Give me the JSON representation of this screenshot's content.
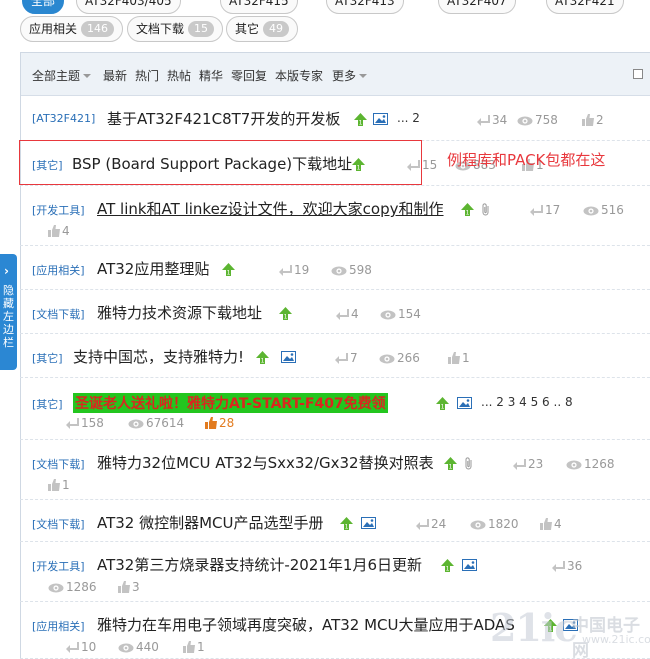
{
  "category_pills": [
    {
      "label": "全部",
      "count": "",
      "active": true
    },
    {
      "label": "AT32F403/405",
      "count": "",
      "active": false
    },
    {
      "label": "AT32F415",
      "count": "",
      "active": false
    },
    {
      "label": "AT32F413",
      "count": "",
      "active": false
    },
    {
      "label": "AT32F407",
      "count": "",
      "active": false
    },
    {
      "label": "AT32F421",
      "count": "",
      "active": false
    },
    {
      "label": "应用相关",
      "count": "146",
      "active": false
    },
    {
      "label": "文档下载",
      "count": "15",
      "active": false
    },
    {
      "label": "其它",
      "count": "49",
      "active": false
    }
  ],
  "toolbar": {
    "all_topics": "全部主题",
    "latest": "最新",
    "hot": "热门",
    "trending": "热帖",
    "digest": "精华",
    "zero_reply": "零回复",
    "expert": "本版专家",
    "more": "更多"
  },
  "sidebar_toggle": {
    "label": "隐藏左边栏"
  },
  "annotation": {
    "text": "例程库和PACK包都在这"
  },
  "threads": [
    {
      "tag": "[AT32F421]",
      "title": "基于AT32F421C8T7开发的开发板",
      "pages": "... 2",
      "replies": "34",
      "views": "758",
      "likes": "2"
    },
    {
      "tag": "[其它]",
      "title": "BSP (Board Support Package)下载地址",
      "pages": "",
      "replies": "15",
      "views": "883",
      "likes": "1"
    },
    {
      "tag": "[开发工具]",
      "title": "AT link和AT linkez设计文件，欢迎大家copy和制作",
      "pages": "",
      "replies": "17",
      "views": "516",
      "likes": "4"
    },
    {
      "tag": "[应用相关]",
      "title": "AT32应用整理贴",
      "pages": "",
      "replies": "19",
      "views": "598",
      "likes": ""
    },
    {
      "tag": "[文档下载]",
      "title": "雅特力技术资源下载地址",
      "pages": "",
      "replies": "4",
      "views": "154",
      "likes": ""
    },
    {
      "tag": "[其它]",
      "title": "支持中国芯，支持雅特力!",
      "pages": "",
      "replies": "7",
      "views": "266",
      "likes": "1"
    },
    {
      "tag": "[其它]",
      "title": "圣诞老人送礼啦！雅特力AT-START-F407免费领",
      "pages": "... 2 3 4 5 6 .. 8",
      "replies": "158",
      "views": "67614",
      "likes": "28"
    },
    {
      "tag": "[文档下载]",
      "title": "雅特力32位MCU AT32与Sxx32/Gx32替换对照表",
      "pages": "",
      "replies": "23",
      "views": "1268",
      "likes": "1"
    },
    {
      "tag": "[文档下载]",
      "title": "AT32 微控制器MCU产品选型手册",
      "pages": "",
      "replies": "24",
      "views": "1820",
      "likes": "4"
    },
    {
      "tag": "[开发工具]",
      "title": "AT32第三方烧录器支持统计-2021年1月6日更新",
      "pages": "",
      "replies": "36",
      "views": "1286",
      "likes": "3"
    },
    {
      "tag": "[应用相关]",
      "title": "雅特力在车用电子领域再度突破，AT32 MCU大量应用于ADAS",
      "pages": "",
      "replies": "10",
      "views": "440",
      "likes": "1"
    }
  ],
  "watermark": {
    "big": "21ic",
    "cn": "中国电子网",
    "url": "www.21ic.com"
  },
  "colors": {
    "accent": "#2a87d0",
    "tag": "#2a6fb7",
    "annotation": "#e8383d",
    "hot": "#e27b1f",
    "highlight_bg": "#23c61f"
  }
}
